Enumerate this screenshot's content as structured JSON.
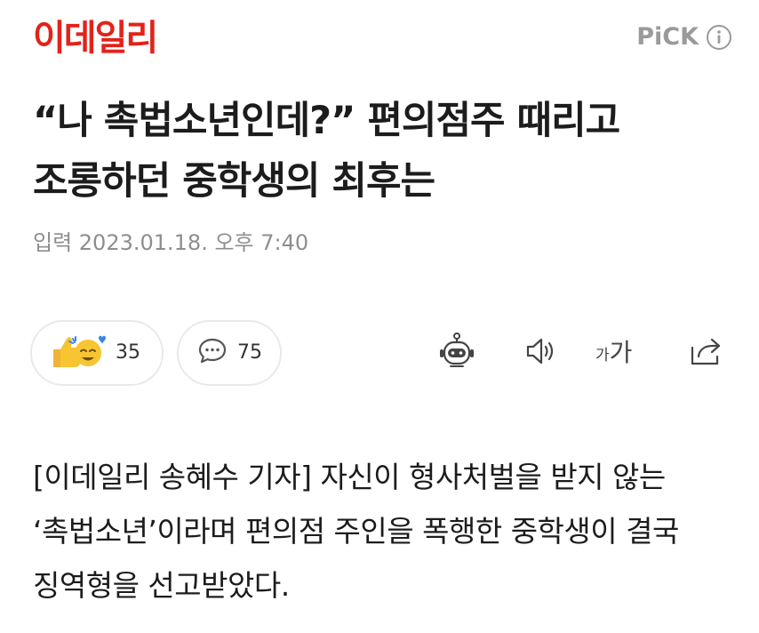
{
  "header": {
    "logo_text": "이데일리",
    "pick_label": "PiCK"
  },
  "article": {
    "headline": "“나 촉법소년인데?” 편의점주 때리고 조롱하던 중학생의 최후는",
    "timestamp": "입력 2023.01.18. 오후 7:40",
    "body": "[이데일리 송혜수 기자] 자신이 형사처벌을 받지 않는 ‘촉법소년’이라며 편의점 주인을 폭행한 중학생이 결국 징역형을 선고받았다."
  },
  "toolbar": {
    "reaction_count": "35",
    "comment_count": "75",
    "font_size_small": "가",
    "font_size_large": "가"
  },
  "icons": {
    "reactions": "thumbs-up-and-heart-face-icon",
    "comments": "speech-bubble-icon",
    "summary_bot": "robot-icon",
    "text_to_speech": "speaker-icon",
    "share": "share-icon",
    "info": "info-icon"
  },
  "colors": {
    "brand_red": "#e2231a",
    "muted_gray": "#8e8e8e",
    "pick_gray": "#9a9a9a",
    "text": "#1c1c1c",
    "emoji_yellow": "#f7c531"
  }
}
